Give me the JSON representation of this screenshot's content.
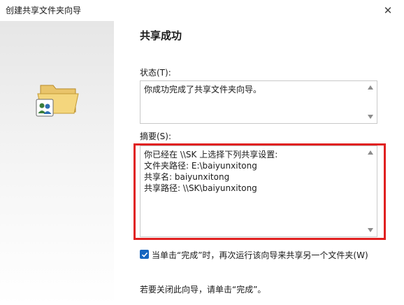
{
  "window": {
    "title": "创建共享文件夹向导",
    "close_symbol": "✕"
  },
  "page": {
    "heading": "共享成功"
  },
  "status": {
    "label": "状态(T):",
    "text": "你成功完成了共享文件夹向导。"
  },
  "summary": {
    "label": "摘要(S):",
    "text": "你已经在 \\\\SK 上选择下列共享设置:\n文件夹路径: E:\\baiyunxitong\n共享名: baiyunxitong\n共享路径: \\\\SK\\baiyunxitong"
  },
  "option": {
    "checked": true,
    "label": "当单击“完成”时，再次运行该向导来共享另一个文件夹(W)"
  },
  "footer": {
    "text": "若要关闭此向导，请单击“完成”。"
  },
  "colors": {
    "highlight": "#e02020",
    "checkbox": "#1565c0",
    "folder": "#f2d27a"
  },
  "icons": [
    "shared-folder-icon",
    "close-icon",
    "checkmark-icon",
    "scroll-up-icon",
    "scroll-down-icon"
  ]
}
